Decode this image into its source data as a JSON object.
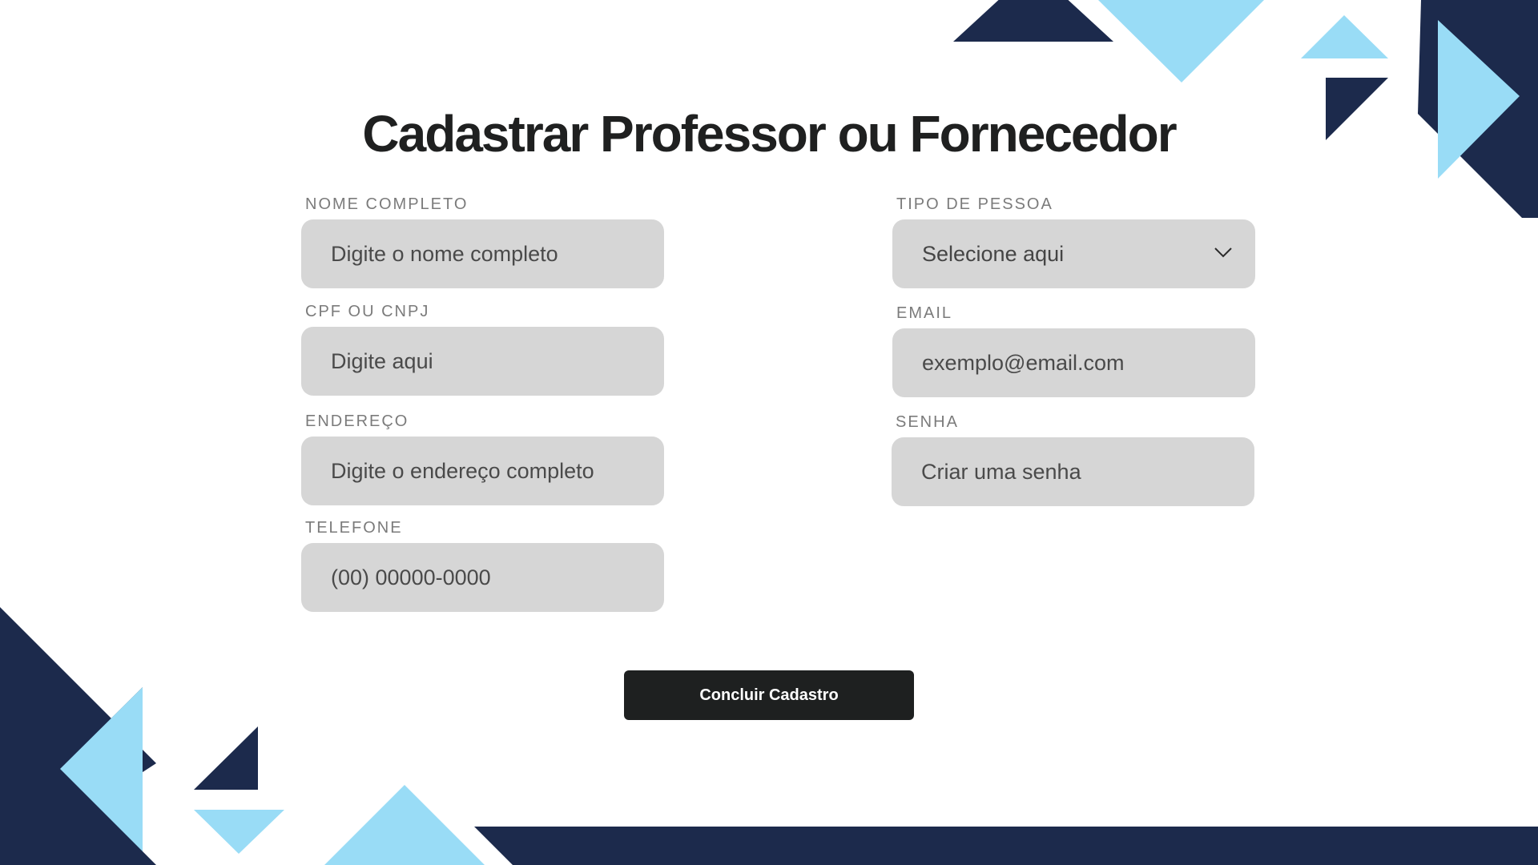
{
  "colors": {
    "navy": "#1c2a4c",
    "light_blue": "#99dcf6",
    "field_bg": "#d6d6d6",
    "button_bg": "#1e2020",
    "title_text": "#1f2020"
  },
  "page": {
    "title": "Cadastrar Professor ou Fornecedor"
  },
  "form": {
    "nome": {
      "label": "NOME COMPLETO",
      "placeholder": "Digite o nome completo"
    },
    "cpf": {
      "label": "CPF OU CNPJ",
      "placeholder": "Digite aqui"
    },
    "endereco": {
      "label": "ENDEREÇO",
      "placeholder": "Digite o endereço completo"
    },
    "telefone": {
      "label": "TELEFONE",
      "placeholder": "(00) 00000-0000"
    },
    "tipo": {
      "label": "TIPO DE PESSOA",
      "selected": "Selecione aqui",
      "icon": "chevron-down-icon"
    },
    "email": {
      "label": "EMAIL",
      "placeholder": "exemplo@email.com"
    },
    "senha": {
      "label": "SENHA",
      "placeholder": "Criar uma senha"
    },
    "submit_label": "Concluir Cadastro"
  }
}
